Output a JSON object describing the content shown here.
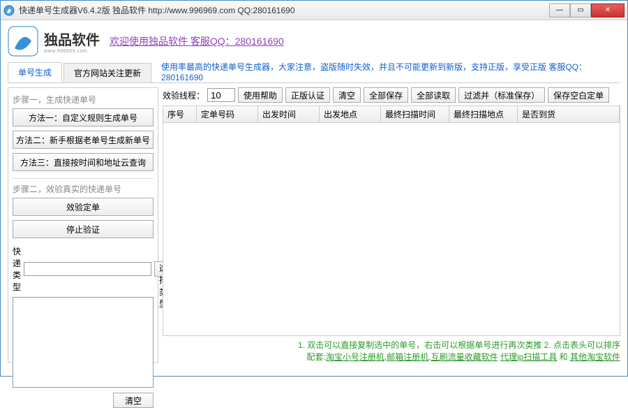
{
  "window": {
    "title": "快递单号生成器V6.4.2版 独品软件 http://www.996969.com QQ:280161690"
  },
  "header": {
    "brand": "独品软件",
    "brand_url": "www.996969.com",
    "welcome": "欢迎使用独品软件 客服QQ：280161690"
  },
  "tabs": [
    "单号生成",
    "官方网站关注更新"
  ],
  "notice": "使用率最高的快递单号生成器，大家注意，盗版随时失效，并且不可能更新到新版，支持正版，享受正版 客服QQ：280161690",
  "left": {
    "step1_label": "步骤一，生成快递单号",
    "method1": "方法一：自定义规则生成单号",
    "method2": "方法二：新手根据老单号生成新单号",
    "method3": "方法三：直接按时间和地址云查询",
    "step2_label": "步骤二，效验真实的快递单号",
    "verify": "效验定单",
    "stop": "停止验证",
    "type_label": "快递类型",
    "type_value": "",
    "select_type": "选择类型",
    "clear": "清空"
  },
  "toolbar": {
    "threads_label": "效验线程：",
    "threads_value": "10",
    "help": "使用帮助",
    "auth": "正版认证",
    "clear": "清空",
    "save_all": "全部保存",
    "load_all": "全部读取",
    "filter_save": "过滤并（标准保存）",
    "save_blank": "保存空白定单"
  },
  "grid": {
    "columns": [
      "序号",
      "定单号码",
      "出发时间",
      "出发地点",
      "最终扫描时间",
      "最终扫描地点",
      "是否到货"
    ]
  },
  "footer": {
    "hint": "1. 双击可以直接复制选中的单号，右击可以根据单号进行再次类推 2. 点击表头可以排序",
    "prefix": "配套:",
    "links": [
      "淘宝小号注册机",
      "邮箱注册机",
      "互刷流量收藏软件",
      "代理ip扫描工具",
      "其他淘宝软件"
    ],
    "and": "和"
  }
}
